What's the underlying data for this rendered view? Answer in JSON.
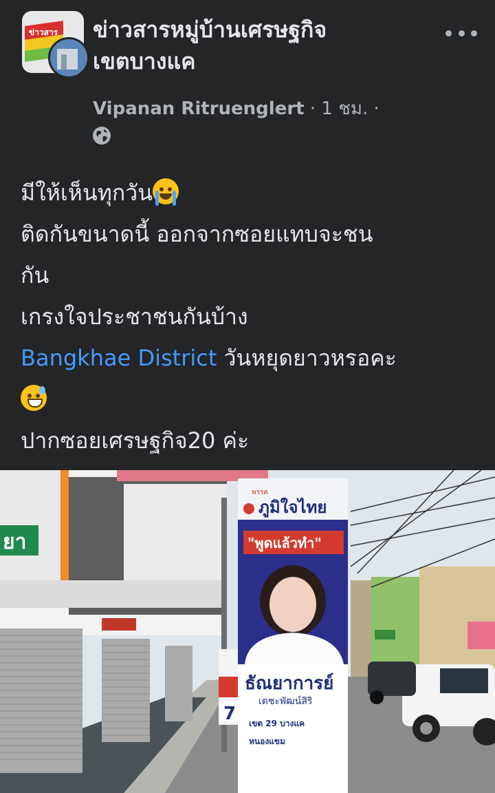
{
  "post": {
    "group_name_line1": "ข่าวสารหมู่บ้านเศรษฐกิจ",
    "group_name_line2": "เขตบางแค",
    "author": "Vipanan Ritruenglert",
    "time": "1 ชม.",
    "separator": " · ",
    "group_avatar_text": "ข่าวสาร",
    "icons": {
      "more": "more-dots-icon",
      "privacy": "globe-icon"
    },
    "text": {
      "line1": "มีให้เห็นทุกวัน",
      "line1_emoji": "crying-face-emoji",
      "line2": "ติดกันขนาดนี้ ออกจากซอยแทบจะชน",
      "line3": "กัน",
      "line4": "เกรงใจประชาชนกันบ้าง",
      "line5_link": "Bangkhae District",
      "line5_rest": " วันหยุดยาวหรอคะ",
      "line6_emoji": "grinning-sweat-emoji",
      "line7": "ปากซอยเศรษฐกิจ20 ค่ะ"
    },
    "photo": {
      "shop_sign": "ยา",
      "banner_party_small": "พรรค",
      "banner_party": "ภูมิใจไทย",
      "banner_slogan": "\"พูดแล้วทำ\"",
      "candidate_name": "ธัณยาการย์",
      "candidate_surname": "เตชะพัฒน์สิริ",
      "district": "เขต 29 บางแค",
      "area": "หนองแขม",
      "small_sign_number": "7"
    }
  },
  "colors": {
    "background": "#242526",
    "text_primary": "#e4e6eb",
    "text_secondary": "#b0b3b8",
    "link": "#4599ff"
  }
}
